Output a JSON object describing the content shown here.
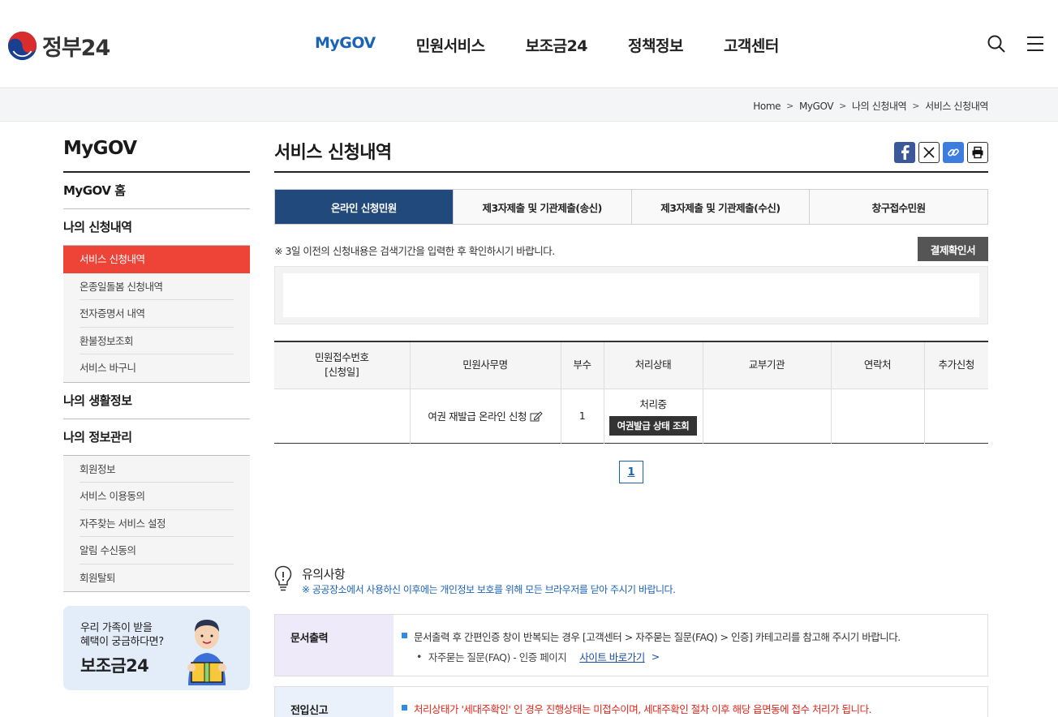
{
  "logo": {
    "text": "정부24"
  },
  "gnb": [
    "MyGOV",
    "민원서비스",
    "보조금24",
    "정책정보",
    "고객센터"
  ],
  "breadcrumb": [
    "Home",
    "MyGOV",
    "나의 신청내역",
    "서비스 신청내역"
  ],
  "sidebar": {
    "title": "MyGOV",
    "home": "MyGOV 홈",
    "groups": [
      {
        "label": "나의 신청내역",
        "items": [
          "서비스 신청내역",
          "온종일돌봄 신청내역",
          "전자증명서 내역",
          "환불정보조회",
          "서비스 바구니"
        ]
      },
      {
        "label": "나의 생활정보",
        "items": []
      },
      {
        "label": "나의 정보관리",
        "items": [
          "회원정보",
          "서비스 이용동의",
          "자주찾는 서비스 설정",
          "알림 수신동의",
          "회원탈퇴"
        ]
      }
    ],
    "banner": {
      "line1": "우리 가족이 받을",
      "line2": "혜택이 궁금하다면?",
      "title": "보조금24"
    }
  },
  "main": {
    "title": "서비스 신청내역",
    "tabs": [
      "온라인 신청민원",
      "제3자제출 및 기관제출(송신)",
      "제3자제출 및 기관제출(수신)",
      "창구접수민원"
    ],
    "notice": "※ 3일 이전의 신청내용은 검색기간을 입력한 후 확인하시기 바랍니다.",
    "confirm_button": "결제확인서",
    "table": {
      "headers": [
        "민원접수번호",
        "[신청일]",
        "민원사무명",
        "부수",
        "처리상태",
        "교부기관",
        "연락처",
        "추가신청"
      ],
      "rows": [
        {
          "name": "여권 재발급 온라인 신청",
          "copies": "1",
          "status": "처리중",
          "status_button": "여권발급 상태 조회"
        }
      ]
    },
    "page": "1",
    "caution": {
      "title": "유의사항",
      "sub": "※ 공공장소에서 사용하신 이후에는 개인정보 보호를 위해 모든 브라우저를 닫아 주시기 바랍니다."
    },
    "guides": [
      {
        "head": "문서출력",
        "line": "문서출력 후 간편인증 창이 반복되는 경우 [고객센터 > 자주묻는 질문(FAQ) > 인증] 카테고리를 참고해 주시기 바랍니다.",
        "sub": "자주묻는 질문(FAQ) - 인증 페이지",
        "link": "사이트 바로가기"
      },
      {
        "head": "전입신고",
        "line": "처리상태가 '세대주확인' 인 경우 진행상태는 미접수이며, 세대주확인 절차 이후 해당 읍면동에 접수 처리가 됩니다."
      }
    ]
  },
  "colors": {
    "accent": "#1b63b6",
    "active_tab": "#22497c",
    "active_side": "#ee4337",
    "warning": "#e2261c"
  }
}
